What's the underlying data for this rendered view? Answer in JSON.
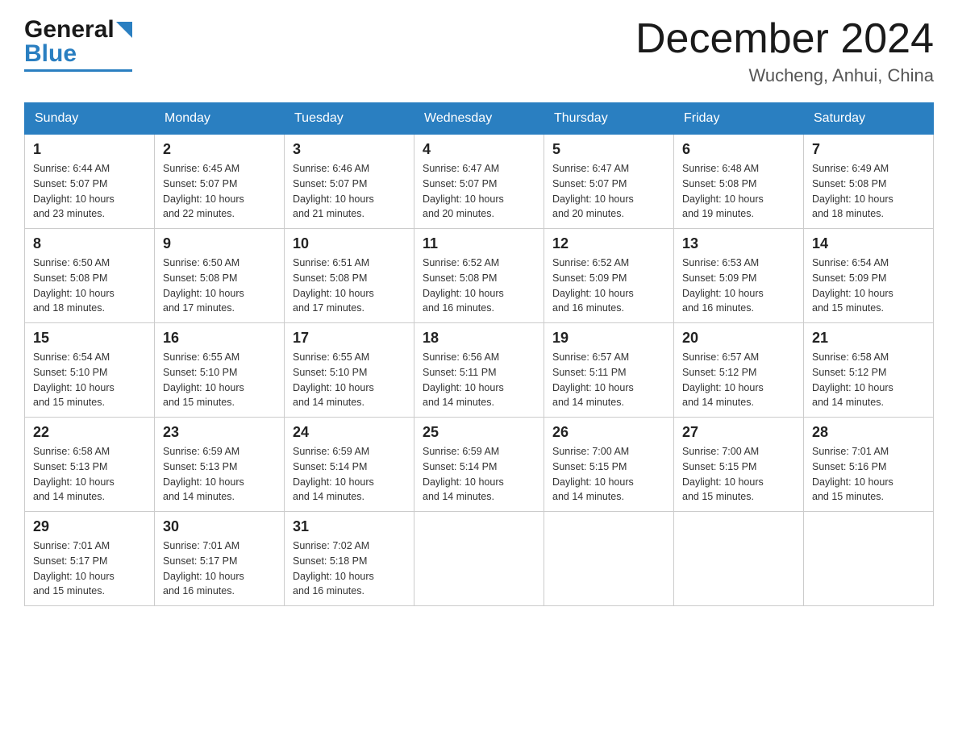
{
  "header": {
    "logo_general": "General",
    "logo_blue": "Blue",
    "month_year": "December 2024",
    "location": "Wucheng, Anhui, China"
  },
  "days_of_week": [
    "Sunday",
    "Monday",
    "Tuesday",
    "Wednesday",
    "Thursday",
    "Friday",
    "Saturday"
  ],
  "weeks": [
    [
      {
        "day": "1",
        "sunrise": "6:44 AM",
        "sunset": "5:07 PM",
        "daylight": "10 hours and 23 minutes."
      },
      {
        "day": "2",
        "sunrise": "6:45 AM",
        "sunset": "5:07 PM",
        "daylight": "10 hours and 22 minutes."
      },
      {
        "day": "3",
        "sunrise": "6:46 AM",
        "sunset": "5:07 PM",
        "daylight": "10 hours and 21 minutes."
      },
      {
        "day": "4",
        "sunrise": "6:47 AM",
        "sunset": "5:07 PM",
        "daylight": "10 hours and 20 minutes."
      },
      {
        "day": "5",
        "sunrise": "6:47 AM",
        "sunset": "5:07 PM",
        "daylight": "10 hours and 20 minutes."
      },
      {
        "day": "6",
        "sunrise": "6:48 AM",
        "sunset": "5:08 PM",
        "daylight": "10 hours and 19 minutes."
      },
      {
        "day": "7",
        "sunrise": "6:49 AM",
        "sunset": "5:08 PM",
        "daylight": "10 hours and 18 minutes."
      }
    ],
    [
      {
        "day": "8",
        "sunrise": "6:50 AM",
        "sunset": "5:08 PM",
        "daylight": "10 hours and 18 minutes."
      },
      {
        "day": "9",
        "sunrise": "6:50 AM",
        "sunset": "5:08 PM",
        "daylight": "10 hours and 17 minutes."
      },
      {
        "day": "10",
        "sunrise": "6:51 AM",
        "sunset": "5:08 PM",
        "daylight": "10 hours and 17 minutes."
      },
      {
        "day": "11",
        "sunrise": "6:52 AM",
        "sunset": "5:08 PM",
        "daylight": "10 hours and 16 minutes."
      },
      {
        "day": "12",
        "sunrise": "6:52 AM",
        "sunset": "5:09 PM",
        "daylight": "10 hours and 16 minutes."
      },
      {
        "day": "13",
        "sunrise": "6:53 AM",
        "sunset": "5:09 PM",
        "daylight": "10 hours and 16 minutes."
      },
      {
        "day": "14",
        "sunrise": "6:54 AM",
        "sunset": "5:09 PM",
        "daylight": "10 hours and 15 minutes."
      }
    ],
    [
      {
        "day": "15",
        "sunrise": "6:54 AM",
        "sunset": "5:10 PM",
        "daylight": "10 hours and 15 minutes."
      },
      {
        "day": "16",
        "sunrise": "6:55 AM",
        "sunset": "5:10 PM",
        "daylight": "10 hours and 15 minutes."
      },
      {
        "day": "17",
        "sunrise": "6:55 AM",
        "sunset": "5:10 PM",
        "daylight": "10 hours and 14 minutes."
      },
      {
        "day": "18",
        "sunrise": "6:56 AM",
        "sunset": "5:11 PM",
        "daylight": "10 hours and 14 minutes."
      },
      {
        "day": "19",
        "sunrise": "6:57 AM",
        "sunset": "5:11 PM",
        "daylight": "10 hours and 14 minutes."
      },
      {
        "day": "20",
        "sunrise": "6:57 AM",
        "sunset": "5:12 PM",
        "daylight": "10 hours and 14 minutes."
      },
      {
        "day": "21",
        "sunrise": "6:58 AM",
        "sunset": "5:12 PM",
        "daylight": "10 hours and 14 minutes."
      }
    ],
    [
      {
        "day": "22",
        "sunrise": "6:58 AM",
        "sunset": "5:13 PM",
        "daylight": "10 hours and 14 minutes."
      },
      {
        "day": "23",
        "sunrise": "6:59 AM",
        "sunset": "5:13 PM",
        "daylight": "10 hours and 14 minutes."
      },
      {
        "day": "24",
        "sunrise": "6:59 AM",
        "sunset": "5:14 PM",
        "daylight": "10 hours and 14 minutes."
      },
      {
        "day": "25",
        "sunrise": "6:59 AM",
        "sunset": "5:14 PM",
        "daylight": "10 hours and 14 minutes."
      },
      {
        "day": "26",
        "sunrise": "7:00 AM",
        "sunset": "5:15 PM",
        "daylight": "10 hours and 14 minutes."
      },
      {
        "day": "27",
        "sunrise": "7:00 AM",
        "sunset": "5:15 PM",
        "daylight": "10 hours and 15 minutes."
      },
      {
        "day": "28",
        "sunrise": "7:01 AM",
        "sunset": "5:16 PM",
        "daylight": "10 hours and 15 minutes."
      }
    ],
    [
      {
        "day": "29",
        "sunrise": "7:01 AM",
        "sunset": "5:17 PM",
        "daylight": "10 hours and 15 minutes."
      },
      {
        "day": "30",
        "sunrise": "7:01 AM",
        "sunset": "5:17 PM",
        "daylight": "10 hours and 16 minutes."
      },
      {
        "day": "31",
        "sunrise": "7:02 AM",
        "sunset": "5:18 PM",
        "daylight": "10 hours and 16 minutes."
      },
      null,
      null,
      null,
      null
    ]
  ],
  "labels": {
    "sunrise": "Sunrise:",
    "sunset": "Sunset:",
    "daylight": "Daylight:"
  }
}
